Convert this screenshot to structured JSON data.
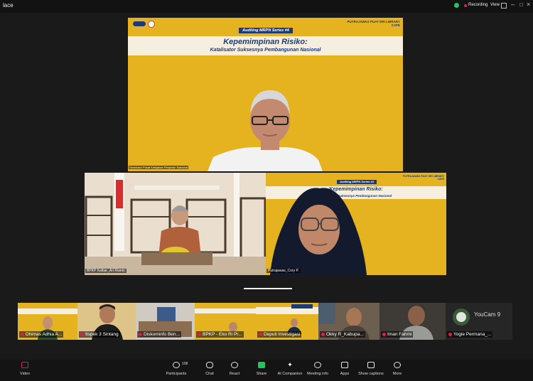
{
  "window": {
    "title": "lace"
  },
  "topbar": {
    "recording_label": "Recording",
    "view_label": "View"
  },
  "main_slide": {
    "series": "Auditing MRPN Series #4",
    "title": "Kepemimpinan Risiko:",
    "subtitle": "Katalisator Suksesnya Pembangunan Nasional",
    "corner": "PUTRAJAWAS PUAT DRI LIBRARY CAFE",
    "speaker_tag": "Eksekutor Pusat Kebijakan Pimpinan Nasional"
  },
  "mid_left": {
    "name": "BPKP Kalbar_Ari Rianto"
  },
  "mid_right": {
    "series": "Auditing MRPN Series #4",
    "title": "Kepemimpinan Risiko:",
    "subtitle": "Katalisator Suksesnya Pembangunan Nasional",
    "corner": "PUTRAJAWAS PUAT DRI LIBRARY CAFE",
    "name": "Putrajawas_Cory P."
  },
  "gallery": [
    {
      "name": "Dhimas Adhia A..."
    },
    {
      "name": "Itspek 3 Sintang"
    },
    {
      "name": "Diskominfo Ben..."
    },
    {
      "name": "BPKP - Eko Ri Pr..."
    },
    {
      "name": "Deputi Investigasi"
    },
    {
      "name": "Okky R_Kabupa..."
    },
    {
      "name": "Iman Fahmi"
    },
    {
      "name": "Yogie Permana_..."
    }
  ],
  "youcam_text": "YouCam 9",
  "toolbar": {
    "video": "Video",
    "participants": "Participants",
    "participants_count": "108",
    "chat": "Chat",
    "react": "React",
    "share": "Share",
    "ai": "AI Companion",
    "meeting_info": "Meeting info",
    "apps": "Apps",
    "captions": "Show captions",
    "more": "More"
  },
  "colors": {
    "slide_yellow": "#e5b320",
    "navy": "#1d3b7a",
    "recording_red": "#e11d48",
    "shield_green": "#22c55e"
  }
}
